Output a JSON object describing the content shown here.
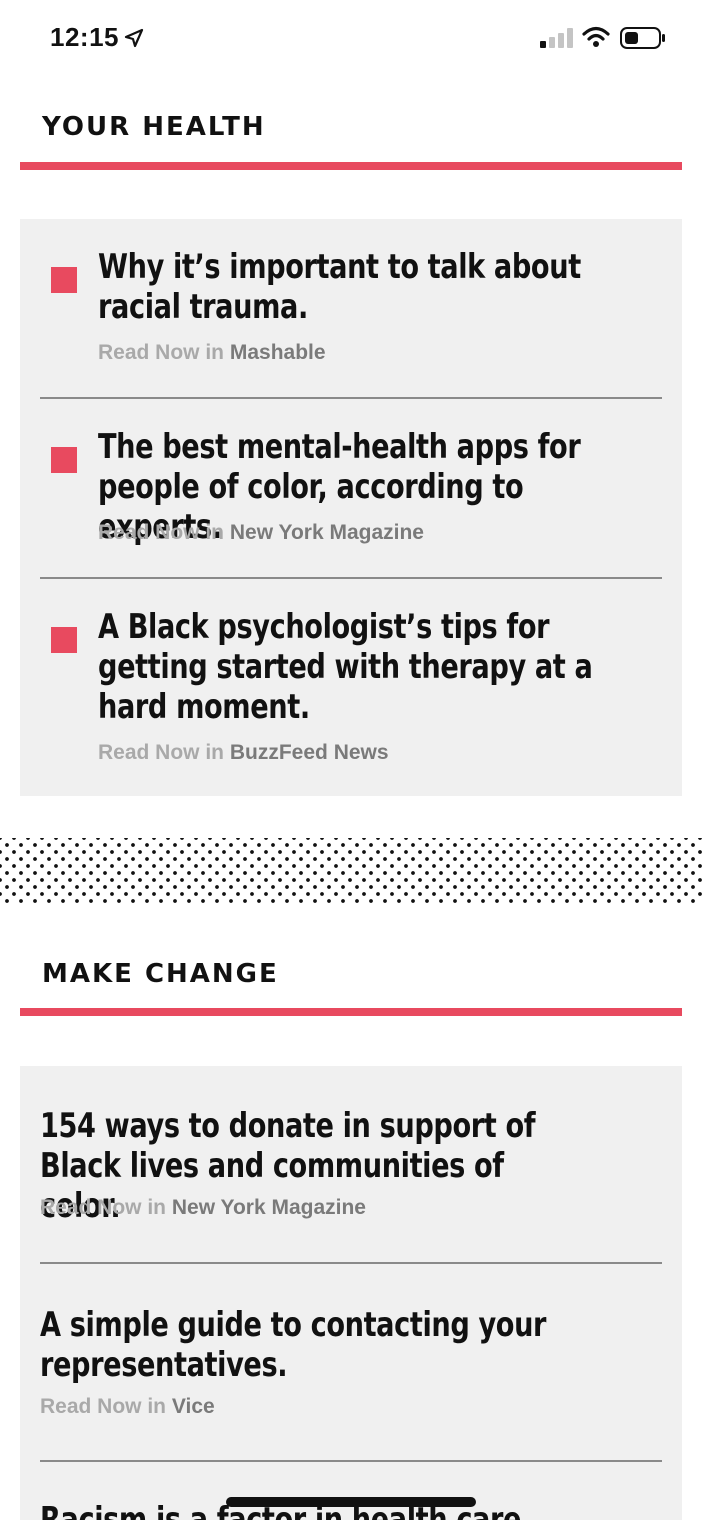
{
  "status_bar": {
    "time": "12:15",
    "icons": [
      "location-arrow-icon",
      "cellular-signal-icon",
      "wifi-icon",
      "battery-icon"
    ]
  },
  "colors": {
    "accent": "#e84a5f",
    "card_bg": "#f0f0f0"
  },
  "sections": [
    {
      "title": "YOUR HEALTH",
      "items": [
        {
          "headline": "Why it’s important to talk about racial trauma.",
          "read_now": "Read Now in",
          "publisher": "Mashable"
        },
        {
          "headline": "The best mental-health apps for people of color, according to experts.",
          "read_now": "Read Now in",
          "publisher": "New York Magazine"
        },
        {
          "headline": "A Black psychologist’s tips for getting started with therapy at a hard moment.",
          "read_now": "Read Now in",
          "publisher": "BuzzFeed News"
        }
      ]
    },
    {
      "title": "MAKE CHANGE",
      "items": [
        {
          "headline": "154 ways to donate in support of Black lives and communities of color.",
          "read_now": "Read Now in",
          "publisher": "New York Magazine"
        },
        {
          "headline": "A simple guide to contacting your representatives.",
          "read_now": "Read Now in",
          "publisher": "Vice"
        },
        {
          "headline": "Racism is a factor in health care, criminal"
        }
      ]
    }
  ]
}
